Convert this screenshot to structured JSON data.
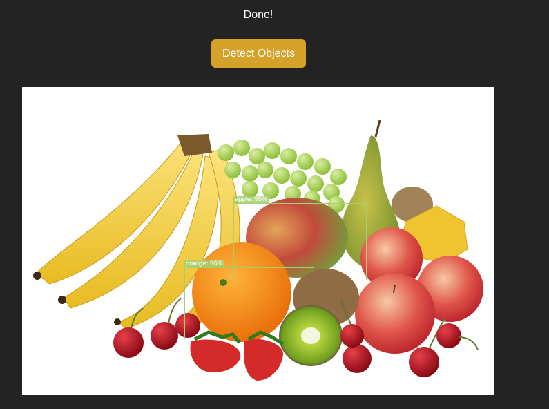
{
  "status": {
    "text": "Done!"
  },
  "toolbar": {
    "detect_label": "Detect Objects"
  },
  "image": {
    "alt": "Assortment of fruits: bananas, grapes, pear, mango, orange, kiwi, apples, strawberries, cherries, star fruit"
  },
  "detections": [
    {
      "label": "apple: 95%",
      "class": "apple",
      "confidence": 0.95
    },
    {
      "label": "orange: 96%",
      "class": "orange",
      "confidence": 0.96
    }
  ],
  "colors": {
    "background": "#232323",
    "button": "#d4a228",
    "bbox": "#a6cf6e"
  }
}
